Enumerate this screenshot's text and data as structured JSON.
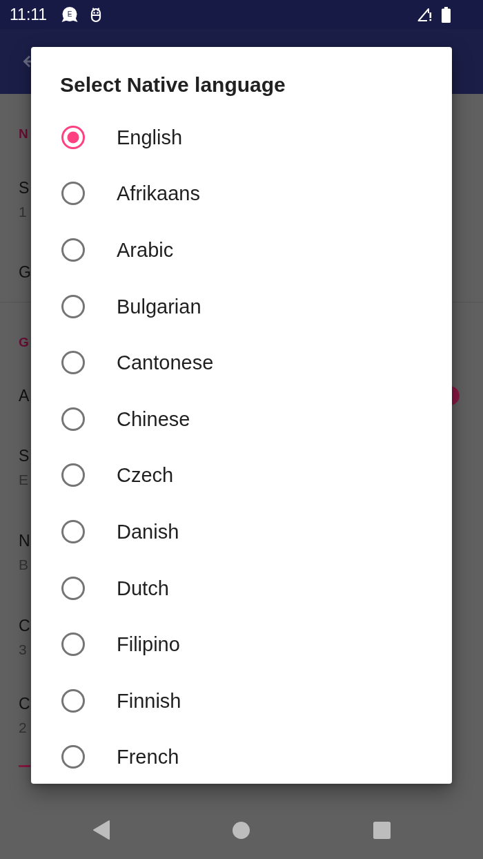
{
  "status_bar": {
    "time": "11:11",
    "notifications": [
      {
        "kind": "bubble",
        "letter": "E"
      },
      {
        "kind": "robot"
      }
    ]
  },
  "settings": {
    "items": [
      {
        "kind": "header",
        "title": "N"
      },
      {
        "kind": "text",
        "title": "S",
        "subtitle": "1"
      },
      {
        "kind": "text",
        "title": "G"
      },
      {
        "kind": "divider"
      },
      {
        "kind": "header",
        "title": "G"
      },
      {
        "kind": "switch",
        "title": "A",
        "on": true
      },
      {
        "kind": "text",
        "title": "S",
        "subtitle": "E"
      },
      {
        "kind": "text",
        "title": "N",
        "subtitle": "B"
      },
      {
        "kind": "text",
        "title": "C",
        "subtitle": "3"
      },
      {
        "kind": "slider",
        "title": "C",
        "subtitle": "2"
      }
    ]
  },
  "dialog": {
    "title": "Select Native language",
    "options": [
      {
        "label": "English",
        "selected": true
      },
      {
        "label": "Afrikaans",
        "selected": false
      },
      {
        "label": "Arabic",
        "selected": false
      },
      {
        "label": "Bulgarian",
        "selected": false
      },
      {
        "label": "Cantonese",
        "selected": false
      },
      {
        "label": "Chinese",
        "selected": false
      },
      {
        "label": "Czech",
        "selected": false
      },
      {
        "label": "Danish",
        "selected": false
      },
      {
        "label": "Dutch",
        "selected": false
      },
      {
        "label": "Filipino",
        "selected": false
      },
      {
        "label": "Finnish",
        "selected": false
      },
      {
        "label": "French",
        "selected": false
      }
    ]
  }
}
